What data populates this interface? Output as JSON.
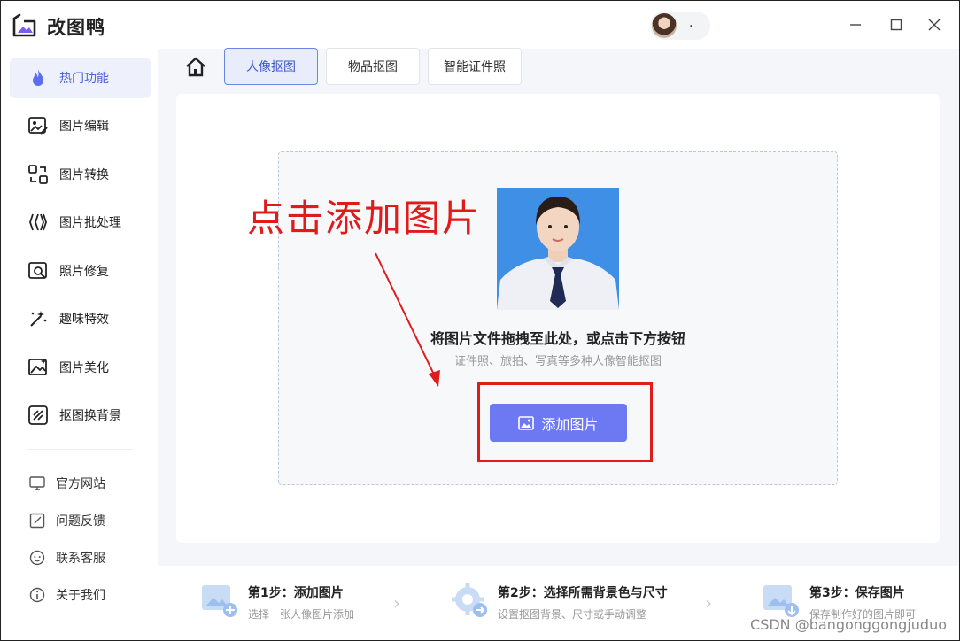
{
  "app": {
    "name": "改图鸭"
  },
  "user": {
    "name": "."
  },
  "window": {
    "minimize": "—",
    "maximize": "☐",
    "close": "✕"
  },
  "sidebar": {
    "items": [
      {
        "label": "热门功能",
        "icon": "flame-icon"
      },
      {
        "label": "图片编辑",
        "icon": "image-edit-icon"
      },
      {
        "label": "图片转换",
        "icon": "convert-icon"
      },
      {
        "label": "图片批处理",
        "icon": "batch-icon"
      },
      {
        "label": "照片修复",
        "icon": "photo-repair-icon"
      },
      {
        "label": "趣味特效",
        "icon": "magic-wand-icon"
      },
      {
        "label": "图片美化",
        "icon": "beautify-icon"
      },
      {
        "label": "抠图换背景",
        "icon": "cutout-icon"
      }
    ],
    "links": [
      {
        "label": "官方网站",
        "icon": "monitor-icon"
      },
      {
        "label": "问题反馈",
        "icon": "feedback-icon"
      },
      {
        "label": "联系客服",
        "icon": "service-icon"
      },
      {
        "label": "关于我们",
        "icon": "info-icon"
      }
    ]
  },
  "tabs": [
    {
      "label": "人像抠图"
    },
    {
      "label": "物品抠图"
    },
    {
      "label": "智能证件照"
    }
  ],
  "dropzone": {
    "title": "将图片文件拖拽至此处，或点击下方按钮",
    "subtitle": "证件照、旅拍、写真等多种人像智能抠图",
    "button_label": "添加图片"
  },
  "annotation": {
    "text": "点击添加图片",
    "color": "#e01b1b"
  },
  "steps": [
    {
      "title": "第1步：添加图片",
      "desc": "选择一张人像图片添加"
    },
    {
      "title": "第2步：选择所需背景色与尺寸",
      "desc": "设置抠图背景、尺寸或手动调整"
    },
    {
      "title": "第3步：保存图片",
      "desc": "保存制作好的图片即可"
    }
  ],
  "watermark": "CSDN @bangonggongjuduo",
  "colors": {
    "accent": "#6d79f2",
    "active_tab": "#3b57c8"
  }
}
